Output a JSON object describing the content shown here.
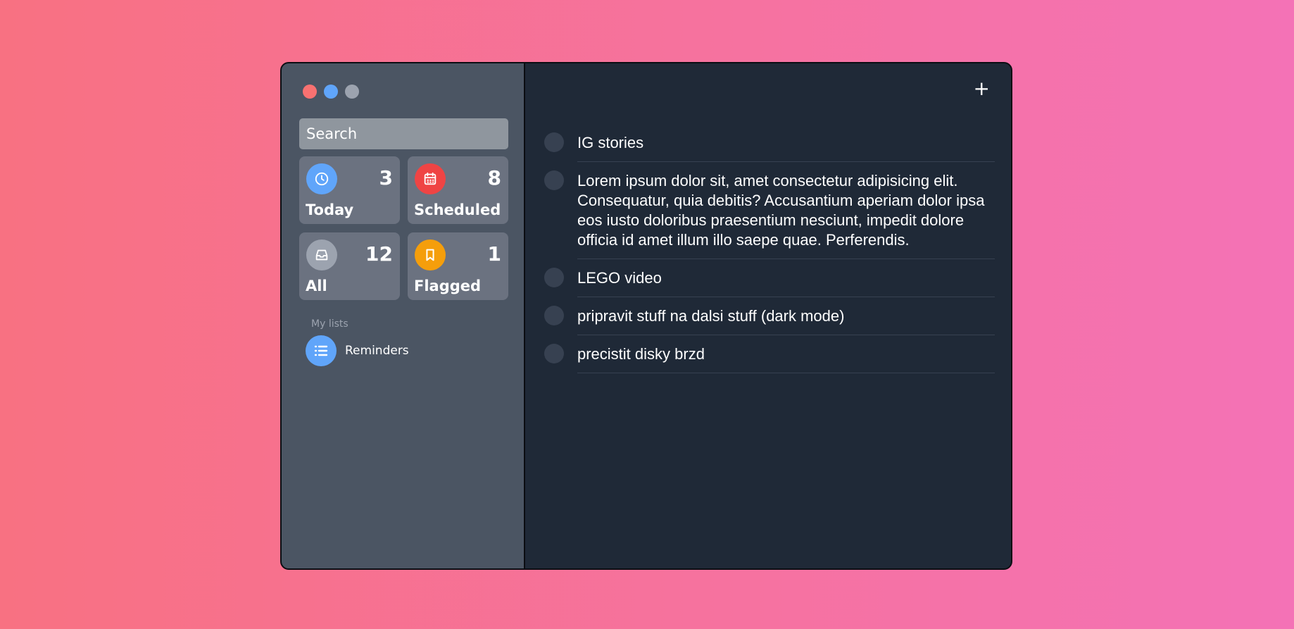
{
  "sidebar": {
    "search": {
      "placeholder": "Search",
      "value": ""
    },
    "cards": [
      {
        "label": "Today",
        "count": "3",
        "icon": "clock-icon",
        "color": "#60a5fa"
      },
      {
        "label": "Scheduled",
        "count": "8",
        "icon": "calendar-icon",
        "color": "#ef4444"
      },
      {
        "label": "All",
        "count": "12",
        "icon": "inbox-icon",
        "color": "#9ca3af"
      },
      {
        "label": "Flagged",
        "count": "1",
        "icon": "bookmark-icon",
        "color": "#f59e0b"
      }
    ],
    "my_lists_title": "My lists",
    "lists": [
      {
        "label": "Reminders",
        "icon": "list-icon",
        "color": "#60a5fa"
      }
    ]
  },
  "main": {
    "add_label": "+",
    "tasks": [
      {
        "text": "IG stories"
      },
      {
        "text": "Lorem ipsum dolor sit, amet consectetur adipisicing elit. Consequatur, quia debitis? Accusantium aperiam dolor ipsa eos iusto doloribus praesentium nesciunt, impedit dolore officia id amet illum illo saepe quae. Perferendis."
      },
      {
        "text": "LEGO video"
      },
      {
        "text": "pripravit stuff na dalsi stuff (dark mode)"
      },
      {
        "text": "precistit disky brzd"
      }
    ]
  }
}
